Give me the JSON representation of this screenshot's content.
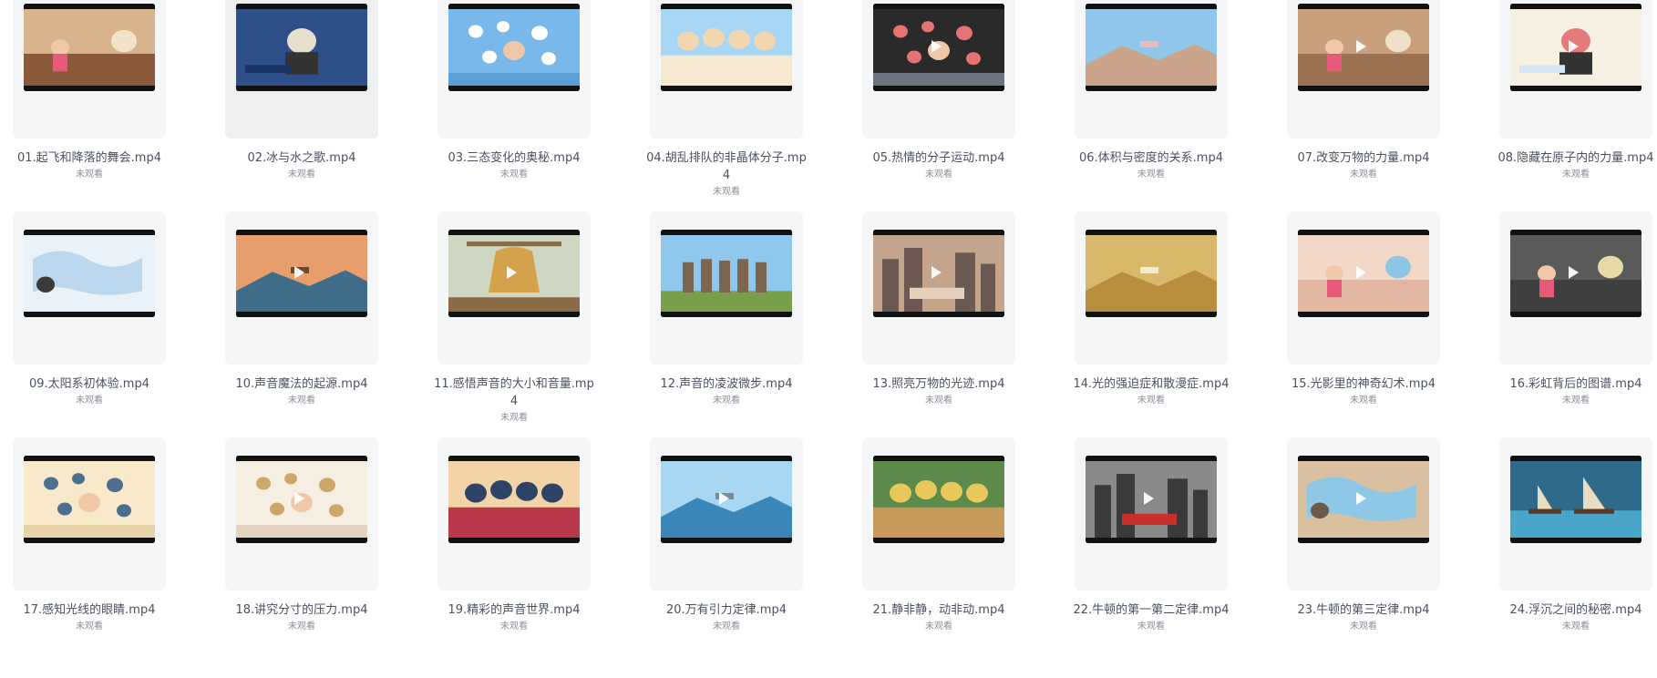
{
  "files": [
    {
      "name": "01.起飞和降落的舞会.mp4",
      "status": "未观看",
      "play": false,
      "scene": {
        "bg": "#d8b48c",
        "ground": "#8a5a3a",
        "accent": "#f2e2c8",
        "shape": "room"
      }
    },
    {
      "name": "02.冰与水之歌.mp4",
      "status": "未观看",
      "play": false,
      "scene": {
        "bg": "#2f4f8a",
        "ground": "#1d3566",
        "accent": "#e8e0cf",
        "shape": "portrait"
      }
    },
    {
      "name": "03.三态变化的奥秘.mp4",
      "status": "未观看",
      "play": false,
      "scene": {
        "bg": "#79b8ea",
        "ground": "#5aa0d8",
        "accent": "#ffffff",
        "shape": "bubbles"
      }
    },
    {
      "name": "04.胡乱排队的非晶体分子.mp4",
      "status": "未观看",
      "play": false,
      "scene": {
        "bg": "#a7d6f4",
        "ground": "#f6e7cf",
        "accent": "#f1d6b0",
        "shape": "crowd"
      }
    },
    {
      "name": "05.热情的分子运动.mp4",
      "status": "未观看",
      "play": true,
      "scene": {
        "bg": "#2a2a2a",
        "ground": "#6b7280",
        "accent": "#e57373",
        "shape": "bubbles"
      }
    },
    {
      "name": "06.体积与密度的关系.mp4",
      "status": "未观看",
      "play": false,
      "scene": {
        "bg": "#8fc6ea",
        "ground": "#c9a38a",
        "accent": "#f0b8b8",
        "shape": "landscape"
      }
    },
    {
      "name": "07.改变万物的力量.mp4",
      "status": "未观看",
      "play": true,
      "scene": {
        "bg": "#caa07c",
        "ground": "#9c7252",
        "accent": "#efe0c8",
        "shape": "room"
      }
    },
    {
      "name": "08.隐藏在原子内的力量.mp4",
      "status": "未观看",
      "play": true,
      "scene": {
        "bg": "#f6f0e3",
        "ground": "#d8e7f5",
        "accent": "#e47b7b",
        "shape": "portrait"
      }
    },
    {
      "name": "09.太阳系初体验.mp4",
      "status": "未观看",
      "play": false,
      "scene": {
        "bg": "#e9f2f8",
        "ground": "#bcd8ee",
        "accent": "#3a3a3a",
        "shape": "map"
      }
    },
    {
      "name": "10.声音魔法的起源.mp4",
      "status": "未观看",
      "play": true,
      "scene": {
        "bg": "#e79e6c",
        "ground": "#3f6d8a",
        "accent": "#6b4a2e",
        "shape": "landscape"
      }
    },
    {
      "name": "11.感悟声音的大小和音量.mp4",
      "status": "未观看",
      "play": true,
      "scene": {
        "bg": "#cfd6c2",
        "ground": "#8b6a46",
        "accent": "#d4a24a",
        "shape": "bell"
      }
    },
    {
      "name": "12.声音的凌波微步.mp4",
      "status": "未观看",
      "play": false,
      "scene": {
        "bg": "#8fc8ec",
        "ground": "#7a9f4a",
        "accent": "#7c6652",
        "shape": "statues"
      }
    },
    {
      "name": "13.照亮万物的光迹.mp4",
      "status": "未观看",
      "play": true,
      "scene": {
        "bg": "#c4a48a",
        "ground": "#6c5a52",
        "accent": "#e6d0bc",
        "shape": "city"
      }
    },
    {
      "name": "14.光的强迫症和散漫症.mp4",
      "status": "未观看",
      "play": false,
      "scene": {
        "bg": "#d8b86a",
        "ground": "#b88e3e",
        "accent": "#f3ead4",
        "shape": "landscape"
      }
    },
    {
      "name": "15.光影里的神奇幻术.mp4",
      "status": "未观看",
      "play": true,
      "scene": {
        "bg": "#f2d8c6",
        "ground": "#e2b6a0",
        "accent": "#8cc6e6",
        "shape": "room"
      }
    },
    {
      "name": "16.彩虹背后的图谱.mp4",
      "status": "未观看",
      "play": true,
      "scene": {
        "bg": "#5a5a5a",
        "ground": "#3f3f3f",
        "accent": "#e8d9a8",
        "shape": "room"
      }
    },
    {
      "name": "17.感知光线的眼睛.mp4",
      "status": "未观看",
      "play": false,
      "scene": {
        "bg": "#f7e9c9",
        "ground": "#e8d3a8",
        "accent": "#4d6e8c",
        "shape": "bubbles"
      }
    },
    {
      "name": "18.讲究分寸的压力.mp4",
      "status": "未观看",
      "play": true,
      "scene": {
        "bg": "#f7eee2",
        "ground": "#e3d3bf",
        "accent": "#cfa66a",
        "shape": "bubbles"
      }
    },
    {
      "name": "19.精彩的声音世界.mp4",
      "status": "未观看",
      "play": false,
      "scene": {
        "bg": "#f3d4a8",
        "ground": "#b9384a",
        "accent": "#2f4366",
        "shape": "crowd"
      }
    },
    {
      "name": "20.万有引力定律.mp4",
      "status": "未观看",
      "play": true,
      "scene": {
        "bg": "#a7d7f2",
        "ground": "#3b86b8",
        "accent": "#7c8a94",
        "shape": "landscape"
      }
    },
    {
      "name": "21.静非静，动非动.mp4",
      "status": "未观看",
      "play": false,
      "scene": {
        "bg": "#5c8a4a",
        "ground": "#c89a5a",
        "accent": "#e8c85a",
        "shape": "crowd"
      }
    },
    {
      "name": "22.牛顿的第一第二定律.mp4",
      "status": "未观看",
      "play": true,
      "scene": {
        "bg": "#8a8a8a",
        "ground": "#3a3a3a",
        "accent": "#c9302c",
        "shape": "city"
      }
    },
    {
      "name": "23.牛顿的第三定律.mp4",
      "status": "未观看",
      "play": true,
      "scene": {
        "bg": "#d8c0a0",
        "ground": "#8fc8e6",
        "accent": "#6b5a4a",
        "shape": "map"
      }
    },
    {
      "name": "24.浮沉之间的秘密.mp4",
      "status": "未观看",
      "play": false,
      "scene": {
        "bg": "#2f6a8a",
        "ground": "#4aa6c8",
        "accent": "#e8dcc2",
        "shape": "ships"
      }
    }
  ]
}
